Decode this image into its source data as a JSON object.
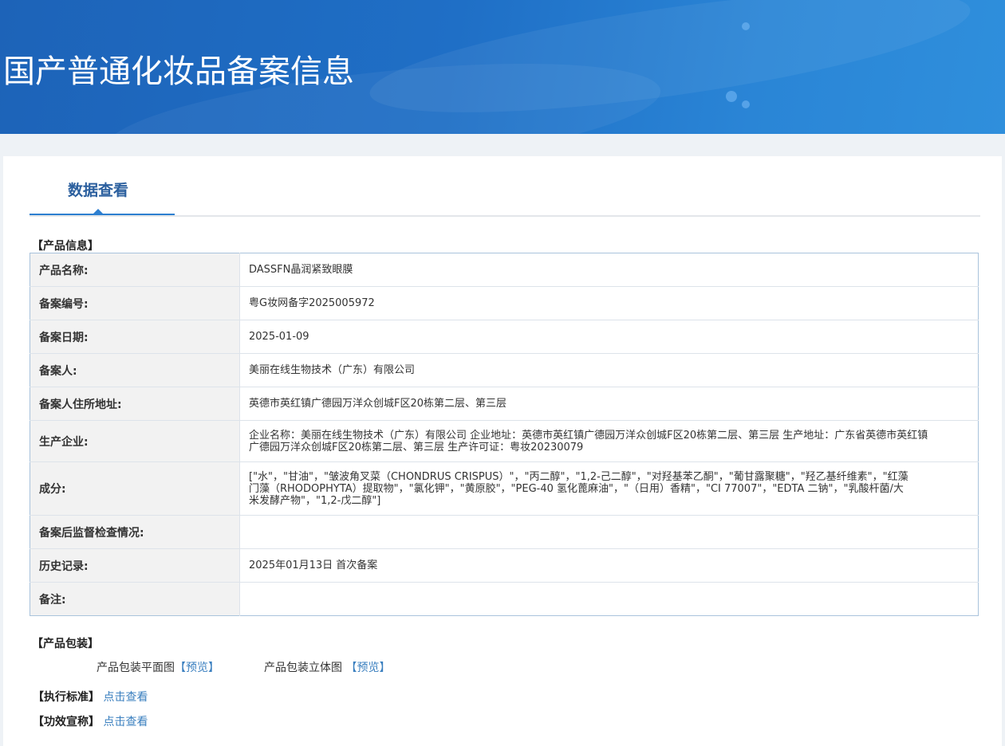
{
  "header": {
    "title": "国产普通化妆品备案信息"
  },
  "tabs": [
    {
      "label": "数据查看"
    }
  ],
  "product_info": {
    "section_label": "【产品信息】",
    "rows": [
      {
        "key": "产品名称:",
        "value": "DASSFN晶润紧致眼膜"
      },
      {
        "key": "备案编号:",
        "value": "粤G妆网备字2025005972"
      },
      {
        "key": "备案日期:",
        "value": "2025-01-09"
      },
      {
        "key": "备案人:",
        "value": "美丽在线生物技术（广东）有限公司"
      },
      {
        "key": "备案人住所地址:",
        "value": "英德市英红镇广德园万洋众创城F区20栋第二层、第三层"
      },
      {
        "key": "生产企业:",
        "value": "企业名称：美丽在线生物技术（广东）有限公司 企业地址：英德市英红镇广德园万洋众创城F区20栋第二层、第三层 生产地址：广东省英德市英红镇广德园万洋众创城F区20栋第二层、第三层 生产许可证：粤妆20230079"
      },
      {
        "key": "成分:",
        "value": "[\"水\"，\"甘油\"，\"皱波角叉菜（CHONDRUS CRISPUS）\"，\"丙二醇\"，\"1,2-己二醇\"，\"对羟基苯乙酮\"，\"葡甘露聚糖\"，\"羟乙基纤维素\"，\"红藻门藻（RHODOPHYTA）提取物\"，\"氯化钾\"，\"黄原胶\"，\"PEG-40 氢化蓖麻油\"，\"（日用）香精\"，\"CI 77007\"，\"EDTA 二钠\"，\"乳酸杆菌/大米发酵产物\"，\"1,2-戊二醇\"]"
      },
      {
        "key": "备案后监督检查情况:",
        "value": ""
      },
      {
        "key": "历史记录:",
        "value": "2025年01月13日 首次备案"
      },
      {
        "key": "备注:",
        "value": ""
      }
    ]
  },
  "packaging": {
    "section_label": "【产品包装】",
    "flat_label": "产品包装平面图",
    "flat_link": "【预览】",
    "solid_label": "产品包装立体图",
    "solid_link": "【预览】"
  },
  "standard": {
    "label": "【执行标准】",
    "link": "点击查看"
  },
  "efficacy": {
    "label": "【功效宣称】",
    "link": "点击查看"
  }
}
